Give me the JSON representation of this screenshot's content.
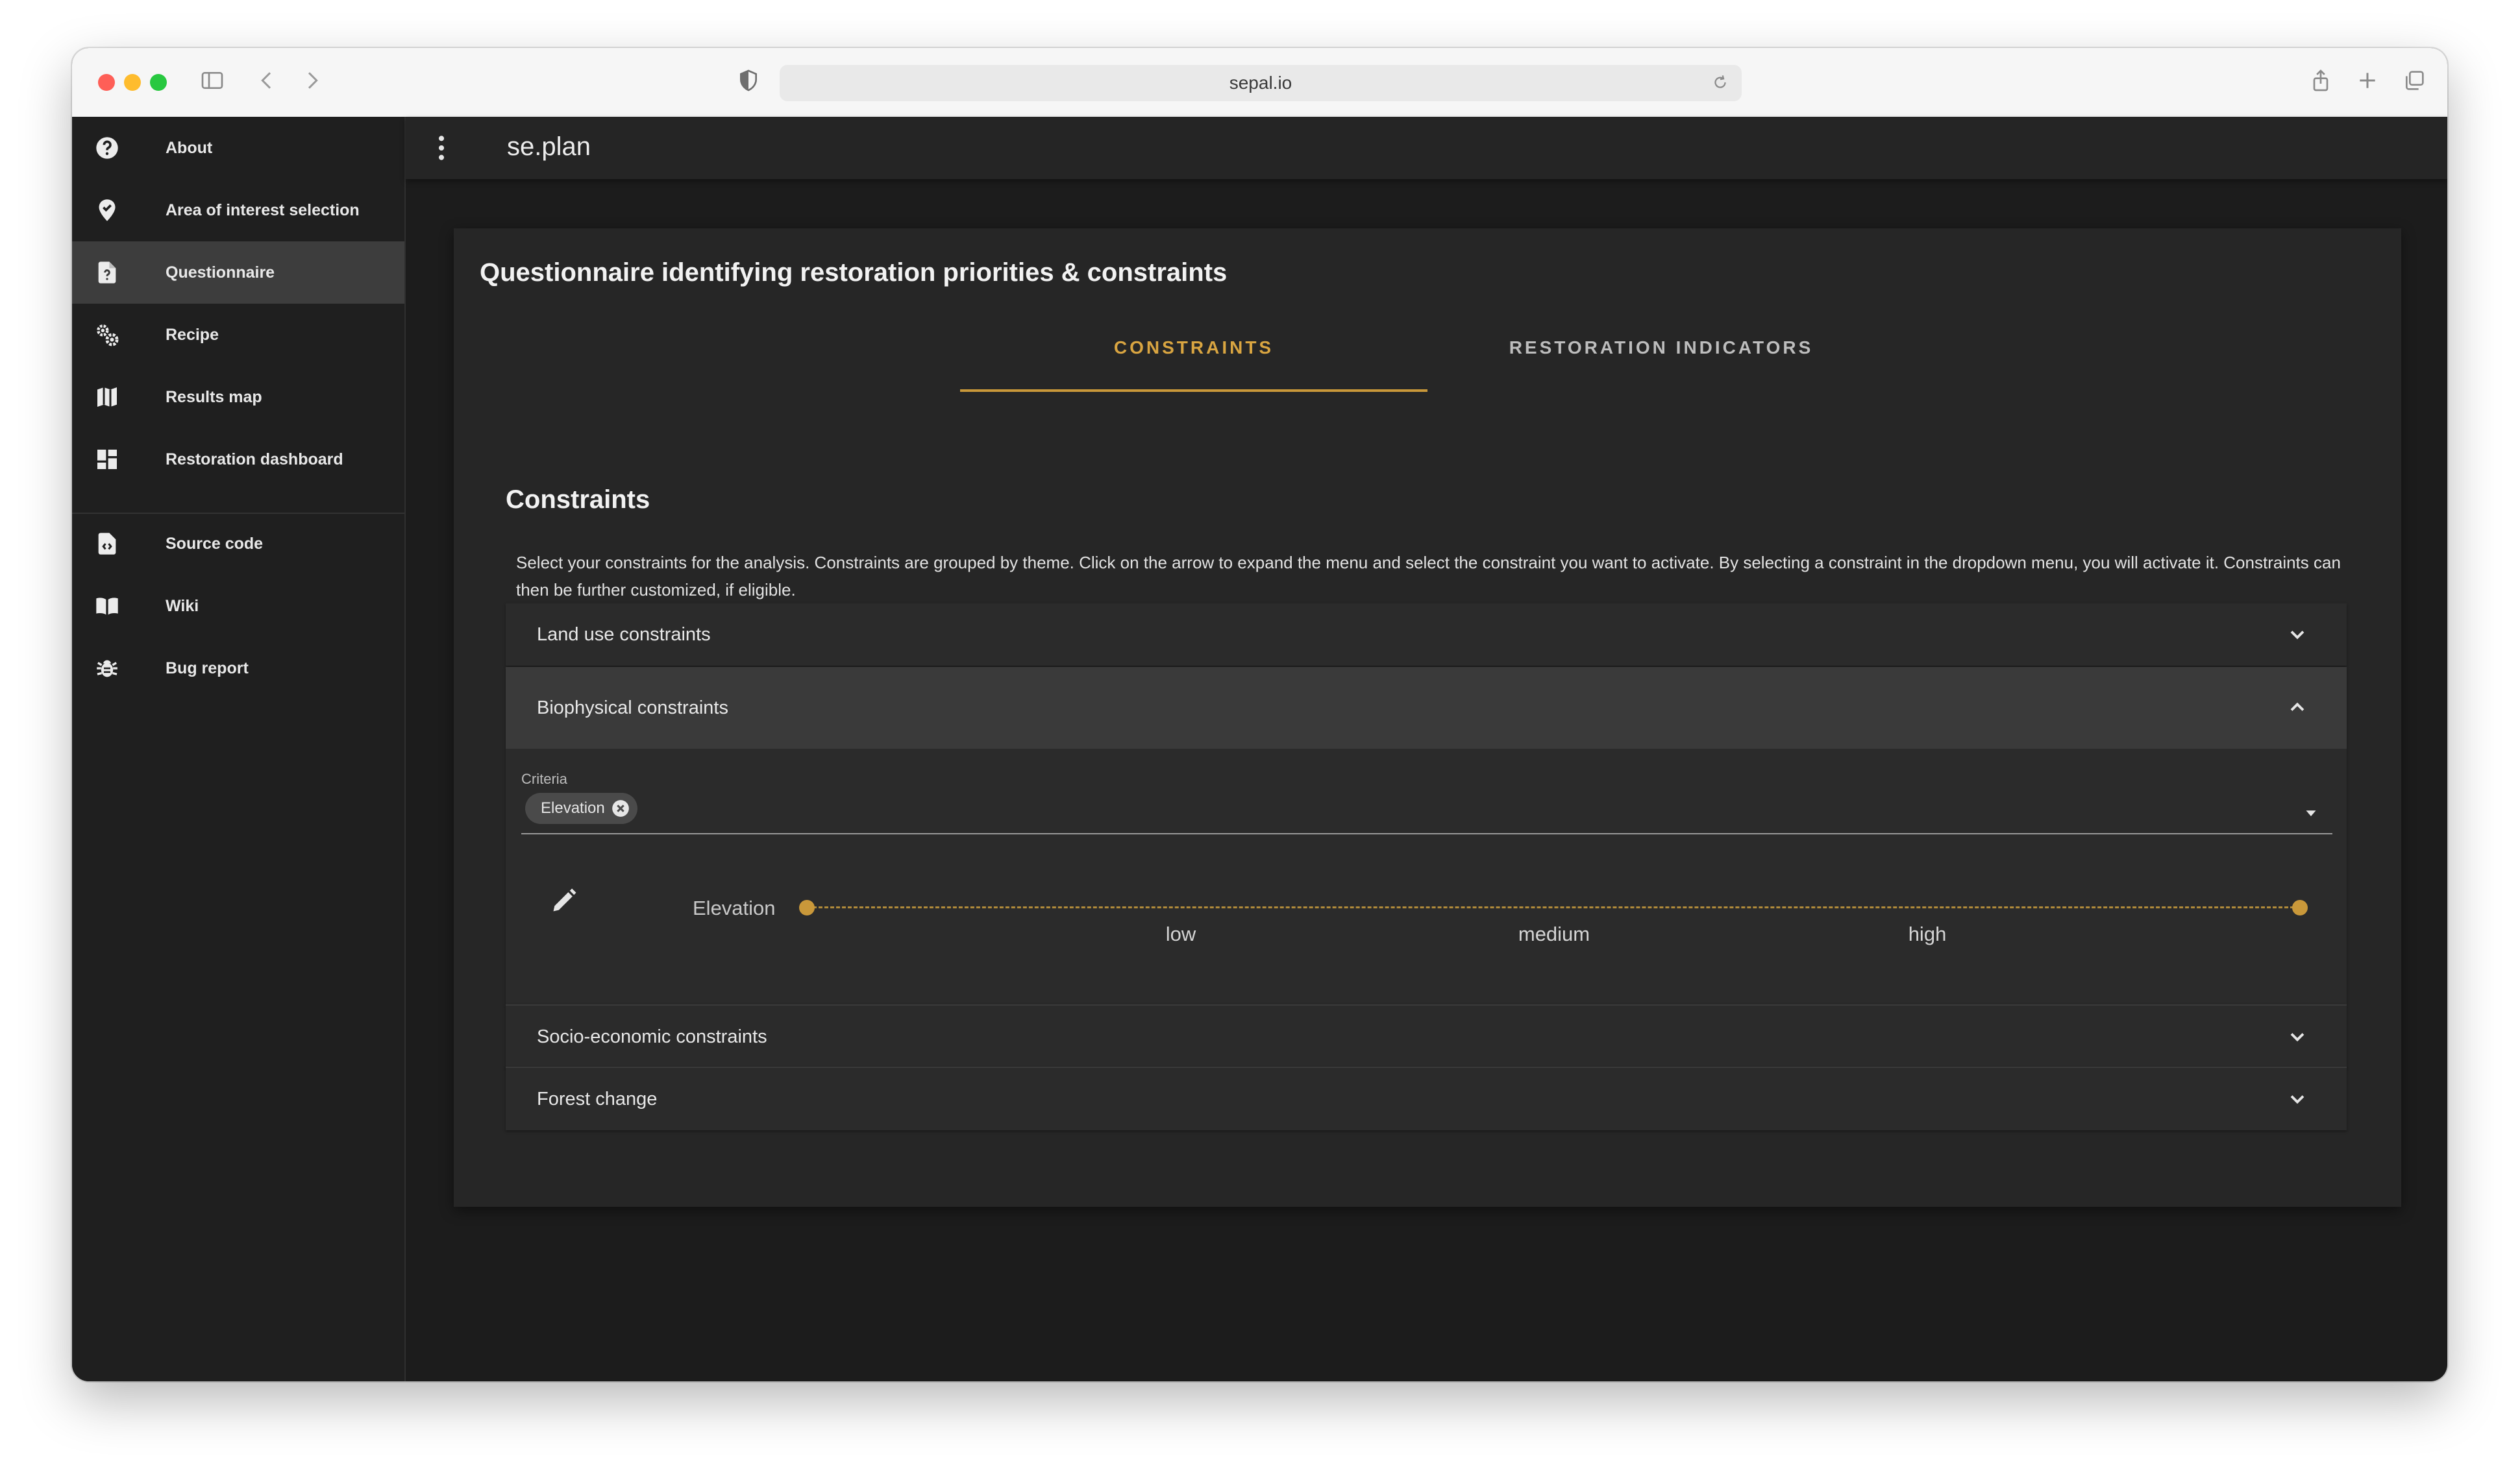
{
  "browser": {
    "url": "sepal.io"
  },
  "sidebar": {
    "items": [
      {
        "label": "About",
        "icon": "help-circle-icon",
        "active": false
      },
      {
        "label": "Area of interest selection",
        "icon": "map-marker-check-icon",
        "active": false
      },
      {
        "label": "Questionnaire",
        "icon": "file-question-icon",
        "active": true
      },
      {
        "label": "Recipe",
        "icon": "cogs-icon",
        "active": false
      },
      {
        "label": "Results map",
        "icon": "map-icon",
        "active": false
      },
      {
        "label": "Restoration dashboard",
        "icon": "dashboard-icon",
        "active": false
      }
    ],
    "links": [
      {
        "label": "Source code",
        "icon": "file-code-icon"
      },
      {
        "label": "Wiki",
        "icon": "book-open-icon"
      },
      {
        "label": "Bug report",
        "icon": "bug-icon"
      }
    ]
  },
  "appbar": {
    "title": "se.plan"
  },
  "card": {
    "title": "Questionnaire identifying restoration priorities & constraints",
    "tabs": [
      {
        "label": "CONSTRAINTS",
        "active": true
      },
      {
        "label": "RESTORATION INDICATORS",
        "active": false
      }
    ]
  },
  "constraints": {
    "title": "Constraints",
    "description": "Select your constraints for the analysis. Constraints are grouped by theme. Click on the arrow to expand the menu and select the constraint you want to activate. By selecting a constraint in the dropdown menu, you will activate it. Constraints can then be further customized, if eligible.",
    "panels": [
      {
        "title": "Land use constraints",
        "expanded": false
      },
      {
        "title": "Biophysical constraints",
        "expanded": true
      },
      {
        "title": "Socio-economic constraints",
        "expanded": false
      },
      {
        "title": "Forest change",
        "expanded": false
      }
    ],
    "biophysical": {
      "criteria_label": "Criteria",
      "selected_chips": [
        "Elevation"
      ],
      "slider": {
        "label": "Elevation",
        "ticks": [
          "low",
          "medium",
          "high"
        ],
        "range": [
          0,
          1
        ]
      }
    }
  },
  "colors": {
    "accent": "#c9983a",
    "background": "#1c1c1c",
    "card": "#262626",
    "active_nav": "#3d3d3d"
  }
}
